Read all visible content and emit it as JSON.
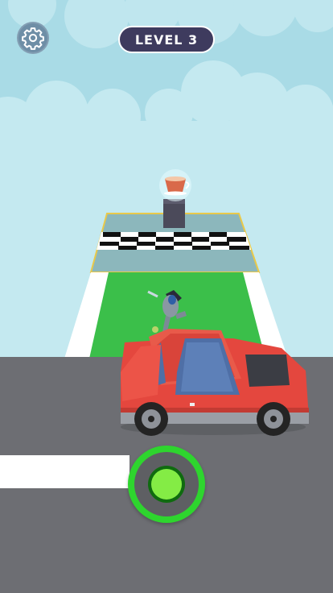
{
  "hud": {
    "level_label": "LEVEL 3",
    "settings_icon": "gear-icon"
  },
  "colors": {
    "sky": "#a9dbe6",
    "road": "#6d6e73",
    "track_green": "#3bbf4a",
    "car_red": "#e4473e",
    "joystick_green": "#2ed52e"
  }
}
